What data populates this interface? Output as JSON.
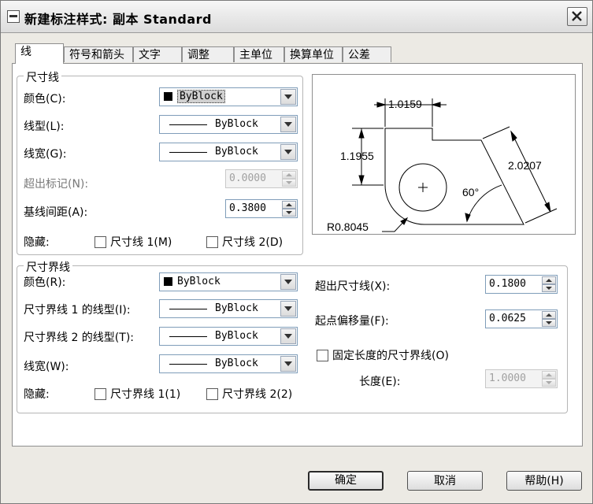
{
  "window": {
    "title": "新建标注样式: 副本 Standard"
  },
  "tabs": [
    {
      "label": "线",
      "active": true
    },
    {
      "label": "符号和箭头"
    },
    {
      "label": "文字"
    },
    {
      "label": "调整"
    },
    {
      "label": "主单位"
    },
    {
      "label": "换算单位"
    },
    {
      "label": "公差"
    }
  ],
  "dim_lines": {
    "title": "尺寸线",
    "color_label": "颜色(C):",
    "color_value": "ByBlock",
    "linetype_label": "线型(L):",
    "linetype_value": "ByBlock",
    "lineweight_label": "线宽(G):",
    "lineweight_value": "ByBlock",
    "extend_ticks_label": "超出标记(N):",
    "extend_ticks_value": "0.0000",
    "baseline_label": "基线间距(A):",
    "baseline_value": "0.3800",
    "suppress_label": "隐藏:",
    "suppress_1": "尺寸线 1(M)",
    "suppress_2": "尺寸线 2(D)"
  },
  "ext_lines": {
    "title": "尺寸界线",
    "color_label": "颜色(R):",
    "color_value": "ByBlock",
    "linetype1_label": "尺寸界线 1 的线型(I):",
    "linetype1_value": "ByBlock",
    "linetype2_label": "尺寸界线 2 的线型(T):",
    "linetype2_value": "ByBlock",
    "lineweight_label": "线宽(W):",
    "lineweight_value": "ByBlock",
    "suppress_label": "隐藏:",
    "suppress_1": "尺寸界线 1(1)",
    "suppress_2": "尺寸界线 2(2)",
    "extend_label": "超出尺寸线(X):",
    "extend_value": "0.1800",
    "offset_label": "起点偏移量(F):",
    "offset_value": "0.0625",
    "fixed_label": "固定长度的尺寸界线(O)",
    "length_label": "长度(E):",
    "length_value": "1.0000"
  },
  "preview": {
    "dim_top": "1.0159",
    "dim_left": "1.1955",
    "dim_right": "2.0207",
    "dim_angle": "60°",
    "dim_radius": "R0.8045"
  },
  "buttons": {
    "ok": "确定",
    "cancel": "取消",
    "help": "帮助(H)"
  }
}
